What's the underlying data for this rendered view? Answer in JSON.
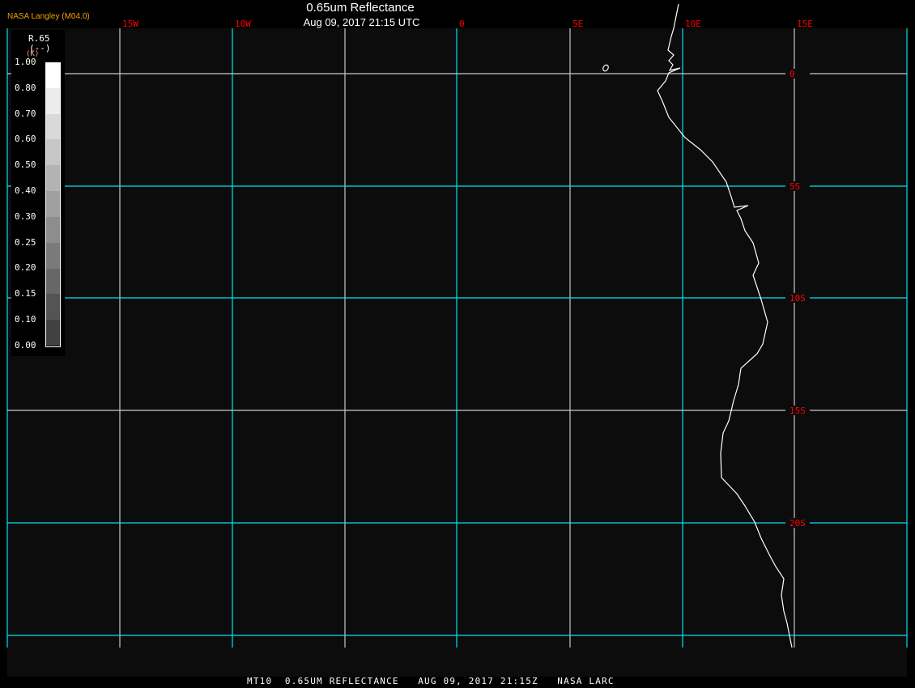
{
  "header": {
    "title": "0.65um Reflectance",
    "subtitle": "Aug 09, 2017 21:15 UTC",
    "brand": "NASA Langley (M04.0)"
  },
  "footer": "MT10  0.65UM REFLECTANCE   AUG 09, 2017 21:15Z   NASA LARC",
  "legend": {
    "name": "R.65",
    "units": "(--)",
    "marker": "(K)",
    "labels": [
      "1.00",
      "0.80",
      "0.70",
      "0.60",
      "0.50",
      "0.40",
      "0.30",
      "0.25",
      "0.20",
      "0.15",
      "0.10",
      "0.00"
    ]
  },
  "grid": {
    "lon_labels": [
      "15W",
      "10W",
      "0",
      "5E",
      "10E",
      "15E"
    ],
    "lat_labels": [
      "0",
      "5S",
      "10S",
      "15S",
      "20S"
    ]
  },
  "colors": {
    "grid_cyan": "#00e5ee",
    "grid_white": "#c8c8c8",
    "label": "#ff0000",
    "background": "#0c0c0c",
    "coastline": "#ffffff"
  }
}
